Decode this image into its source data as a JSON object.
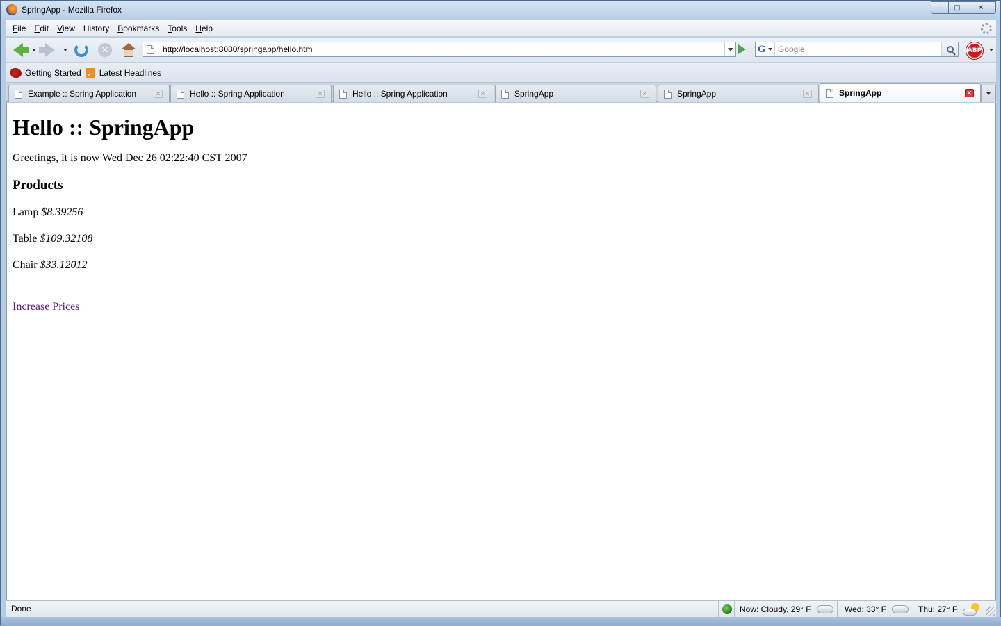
{
  "window": {
    "title": "SpringApp - Mozilla Firefox"
  },
  "menu": {
    "items": [
      {
        "label": "File",
        "key": "F",
        "rest": "ile"
      },
      {
        "label": "Edit",
        "key": "E",
        "rest": "dit"
      },
      {
        "label": "View",
        "key": "V",
        "rest": "iew"
      },
      {
        "label": "History",
        "key": "",
        "rest": "History"
      },
      {
        "label": "Bookmarks",
        "key": "B",
        "rest": "ookmarks"
      },
      {
        "label": "Tools",
        "key": "T",
        "rest": "ools"
      },
      {
        "label": "Help",
        "key": "H",
        "rest": "elp"
      }
    ]
  },
  "navbar": {
    "url": "http://localhost:8080/springapp/hello.htm",
    "search_placeholder": "Google",
    "adblock_label": "ABP"
  },
  "bookmarks": {
    "items": [
      {
        "label": "Getting Started",
        "icon": "firefox-bookmark-icon"
      },
      {
        "label": "Latest Headlines",
        "icon": "rss-feed-icon"
      }
    ]
  },
  "tabs": [
    {
      "label": "Example :: Spring Application",
      "active": false
    },
    {
      "label": "Hello :: Spring Application",
      "active": false
    },
    {
      "label": "Hello :: Spring Application",
      "active": false
    },
    {
      "label": "SpringApp",
      "active": false
    },
    {
      "label": "SpringApp",
      "active": false
    },
    {
      "label": "SpringApp",
      "active": true
    }
  ],
  "page": {
    "heading": "Hello :: SpringApp",
    "greeting": "Greetings, it is now Wed Dec 26 02:22:40 CST 2007",
    "products_heading": "Products",
    "products": [
      {
        "name": "Lamp",
        "price": "$8.39256"
      },
      {
        "name": "Table",
        "price": "$109.32108"
      },
      {
        "name": "Chair",
        "price": "$33.12012"
      }
    ],
    "link_label": "Increase Prices"
  },
  "statusbar": {
    "status": "Done",
    "weather_now": "Now: Cloudy, 29° F",
    "weather_wed": "Wed: 33° F",
    "weather_thu": "Thu: 27° F"
  }
}
